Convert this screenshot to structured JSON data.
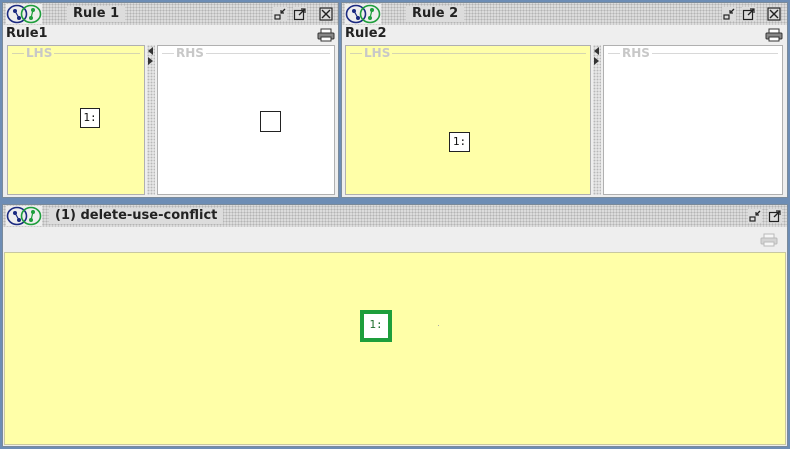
{
  "rule1": {
    "title": "Rule 1",
    "subtitle": "Rule1",
    "lhs_label": "LHS",
    "rhs_label": "RHS",
    "lhs_node": "1:",
    "rhs_node": ""
  },
  "rule2": {
    "title": "Rule 2",
    "subtitle": "Rule2",
    "lhs_label": "LHS",
    "rhs_label": "RHS",
    "lhs_node": "1:"
  },
  "conflict": {
    "title": "(1) delete-use-conflict",
    "node": "1:"
  },
  "icons": {
    "window_logo": "graph-logo-icon",
    "iconify": "iconify-icon",
    "maximize": "maximize-icon",
    "close": "close-icon",
    "print": "print-icon"
  },
  "colors": {
    "graph_yellow": "#ffffa8",
    "match_green": "#1e9e3c",
    "desktop_blue": "#6d8db5"
  }
}
